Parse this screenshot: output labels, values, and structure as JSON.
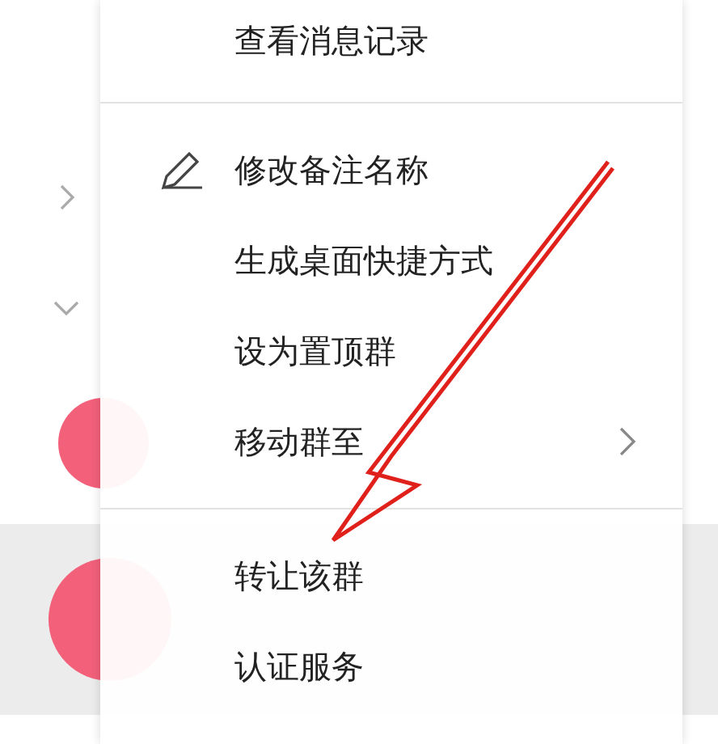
{
  "groups": [
    {
      "expanded": false
    },
    {
      "expanded": true
    }
  ],
  "menu": {
    "items": [
      {
        "kind": "item",
        "label": "查看消息记录"
      },
      {
        "kind": "separator"
      },
      {
        "kind": "item",
        "label": "修改备注名称",
        "icon": true
      },
      {
        "kind": "item",
        "label": "生成桌面快捷方式"
      },
      {
        "kind": "item",
        "label": "设为置顶群"
      },
      {
        "kind": "item",
        "label": "移动群至",
        "submenu": true
      },
      {
        "kind": "separator"
      },
      {
        "kind": "item",
        "label": "转让该群"
      },
      {
        "kind": "item",
        "label": "认证服务"
      }
    ]
  }
}
